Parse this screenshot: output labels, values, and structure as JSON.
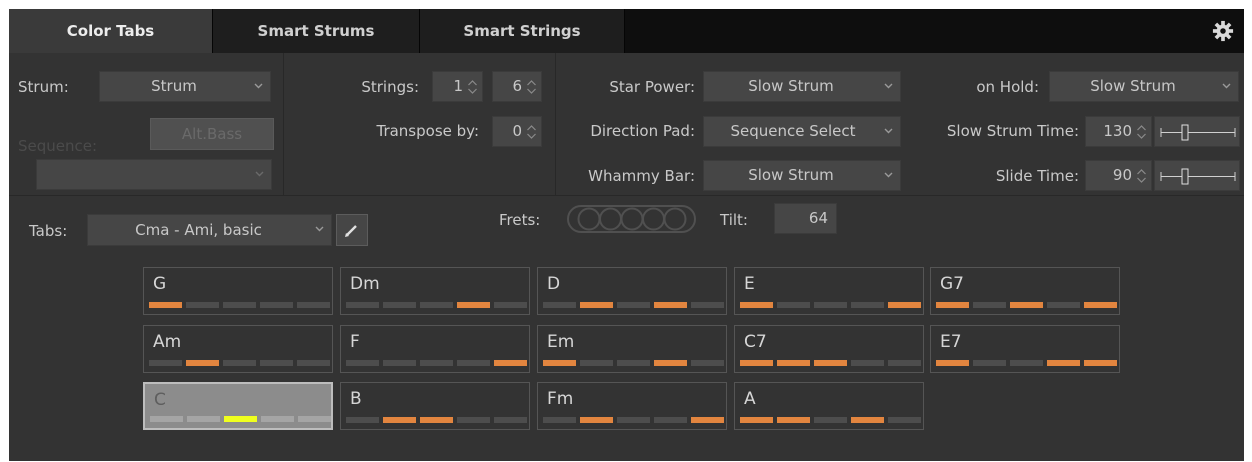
{
  "tabs": [
    {
      "label": "Color Tabs",
      "active": true
    },
    {
      "label": "Smart Strums",
      "active": false
    },
    {
      "label": "Smart Strings",
      "active": false
    }
  ],
  "left": {
    "strum_label": "Strum:",
    "strum_value": "Strum",
    "sequence_label": "Sequence:",
    "alt_bass_label": "Alt.Bass",
    "sequence_value": ""
  },
  "strings": {
    "label": "Strings:",
    "from": "1",
    "to": "6",
    "transpose_label": "Transpose by:",
    "transpose": "0"
  },
  "controllers": {
    "star_power_label": "Star Power:",
    "star_power": "Slow Strum",
    "direction_pad_label": "Direction Pad:",
    "direction_pad": "Sequence Select",
    "whammy_label": "Whammy Bar:",
    "whammy": "Slow Strum"
  },
  "timing": {
    "on_hold_label": "on Hold:",
    "on_hold": "Slow Strum",
    "slow_strum_time_label": "Slow Strum Time:",
    "slow_strum_time": "130",
    "slide_time_label": "Slide Time:",
    "slide_time": "90"
  },
  "tabs_row": {
    "tabs_label": "Tabs:",
    "tabs_value": "Cma - Ami, basic",
    "frets_label": "Frets:",
    "tilt_label": "Tilt:",
    "tilt": "64"
  },
  "chords": [
    {
      "name": "G",
      "frets": [
        1,
        0,
        0,
        0,
        0
      ]
    },
    {
      "name": "Dm",
      "frets": [
        0,
        0,
        0,
        1,
        0
      ]
    },
    {
      "name": "D",
      "frets": [
        0,
        1,
        0,
        1,
        0
      ]
    },
    {
      "name": "E",
      "frets": [
        1,
        0,
        0,
        0,
        1
      ]
    },
    {
      "name": "G7",
      "frets": [
        1,
        0,
        1,
        0,
        1
      ]
    },
    {
      "name": "Am",
      "frets": [
        0,
        1,
        0,
        0,
        0
      ]
    },
    {
      "name": "F",
      "frets": [
        0,
        0,
        0,
        0,
        1
      ]
    },
    {
      "name": "Em",
      "frets": [
        1,
        0,
        0,
        1,
        0
      ]
    },
    {
      "name": "C7",
      "frets": [
        1,
        1,
        1,
        0,
        0
      ]
    },
    {
      "name": "E7",
      "frets": [
        1,
        0,
        0,
        1,
        1
      ]
    },
    {
      "name": "C",
      "frets": [
        0,
        0,
        0,
        0,
        0
      ],
      "selected": true,
      "highlight": 2
    },
    {
      "name": "B",
      "frets": [
        0,
        1,
        1,
        0,
        0
      ]
    },
    {
      "name": "Fm",
      "frets": [
        0,
        1,
        0,
        0,
        1
      ]
    },
    {
      "name": "A",
      "frets": [
        1,
        1,
        0,
        1,
        0
      ]
    }
  ],
  "colors": {
    "fret_active": "#e2853f",
    "fret_highlight": "#f0ff1e",
    "background": "#333333"
  },
  "icons": {
    "settings": "gear-icon",
    "edit": "pencil-icon"
  }
}
